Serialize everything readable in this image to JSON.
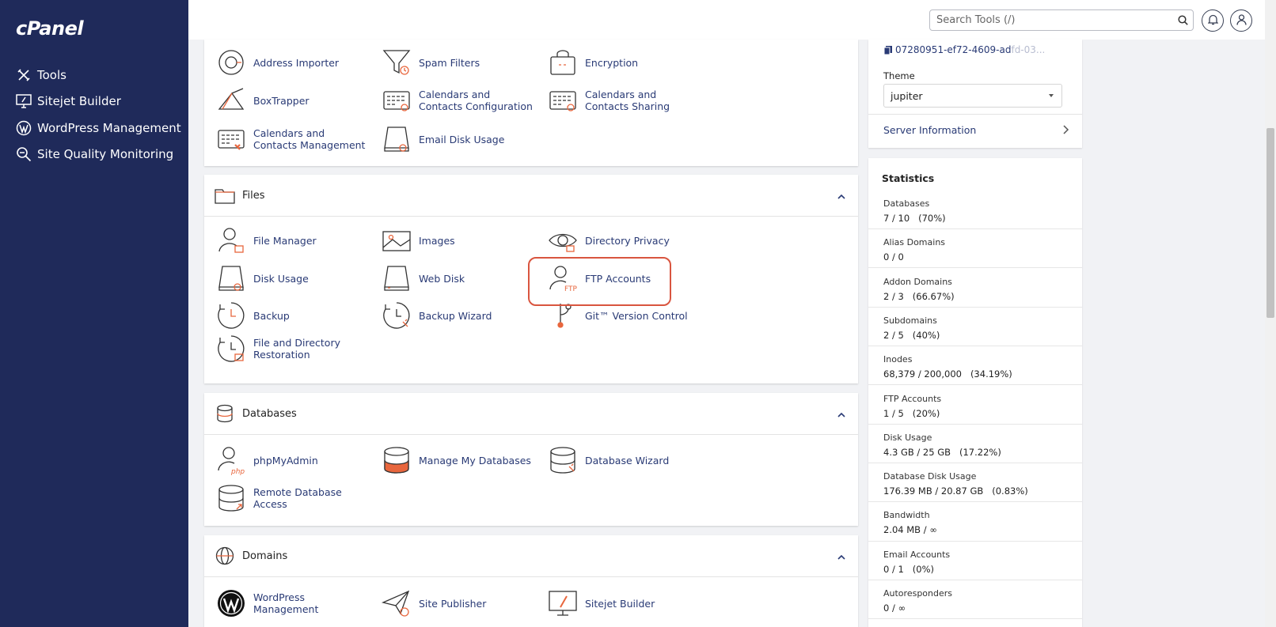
{
  "app": {
    "logo": "cPanel"
  },
  "sidebar": {
    "items": [
      {
        "label": "Tools",
        "icon": "tools-icon"
      },
      {
        "label": "Sitejet Builder",
        "icon": "monitor-icon"
      },
      {
        "label": "WordPress Management",
        "icon": "wordpress-icon"
      },
      {
        "label": "Site Quality Monitoring",
        "icon": "magnifier-icon"
      }
    ]
  },
  "topbar": {
    "search_placeholder": "Search Tools (/)"
  },
  "email_tools": [
    {
      "label": "Address Importer",
      "icon": "address-importer-icon"
    },
    {
      "label": "Spam Filters",
      "icon": "spam-filter-icon"
    },
    {
      "label": "Encryption",
      "icon": "encryption-icon"
    },
    {
      "label": "BoxTrapper",
      "icon": "boxtrapper-icon"
    },
    {
      "label": "Calendars and Contacts Configuration",
      "icon": "calendar-config-icon"
    },
    {
      "label": "Calendars and Contacts Sharing",
      "icon": "calendar-sharing-icon"
    },
    {
      "label": "Calendars and Contacts Management",
      "icon": "calendar-management-icon"
    },
    {
      "label": "Email Disk Usage",
      "icon": "email-disk-usage-icon"
    }
  ],
  "files": {
    "title": "Files",
    "tools": [
      {
        "label": "File Manager"
      },
      {
        "label": "Images"
      },
      {
        "label": "Directory Privacy"
      },
      {
        "label": "Disk Usage"
      },
      {
        "label": "Web Disk"
      },
      {
        "label": "FTP Accounts",
        "icon_text": "FTP"
      },
      {
        "label": "Backup"
      },
      {
        "label": "Backup Wizard"
      },
      {
        "label": "Git™ Version Control"
      },
      {
        "label": "File and Directory Restoration"
      }
    ]
  },
  "databases": {
    "title": "Databases",
    "tools": [
      {
        "label": "phpMyAdmin",
        "icon_text": "php"
      },
      {
        "label": "Manage My Databases"
      },
      {
        "label": "Database Wizard"
      },
      {
        "label": "Remote Database Access"
      }
    ]
  },
  "domains": {
    "title": "Domains",
    "tools": [
      {
        "label": "WordPress Management"
      },
      {
        "label": "Site Publisher"
      },
      {
        "label": "Sitejet Builder"
      }
    ]
  },
  "general_info": {
    "uuid": "07280951-ef72-4609-ad",
    "uuid_faded": "fd-03...",
    "theme_label": "Theme",
    "theme_value": "jupiter",
    "server_info": "Server Information"
  },
  "statistics": {
    "title": "Statistics",
    "items": [
      {
        "label": "Databases",
        "value": "7 / 10   (70%)"
      },
      {
        "label": "Alias Domains",
        "value": "0 / 0"
      },
      {
        "label": "Addon Domains",
        "value": "2 / 3   (66.67%)"
      },
      {
        "label": "Subdomains",
        "value": "2 / 5   (40%)"
      },
      {
        "label": "Inodes",
        "value": "68,379 / 200,000   (34.19%)"
      },
      {
        "label": "FTP Accounts",
        "value": "1 / 5   (20%)"
      },
      {
        "label": "Disk Usage",
        "value": "4.3 GB / 25 GB   (17.22%)"
      },
      {
        "label": "Database Disk Usage",
        "value": "176.39 MB / 20.87 GB   (0.83%)"
      },
      {
        "label": "Bandwidth",
        "value": "2.04 MB / ∞"
      },
      {
        "label": "Email Accounts",
        "value": "0 / 1   (0%)"
      },
      {
        "label": "Autoresponders",
        "value": "0 / ∞"
      }
    ]
  },
  "colors": {
    "sidebar": "#1f2a5a",
    "accent": "#e8663d",
    "link": "#293a75",
    "highlight": "#d9553f"
  }
}
